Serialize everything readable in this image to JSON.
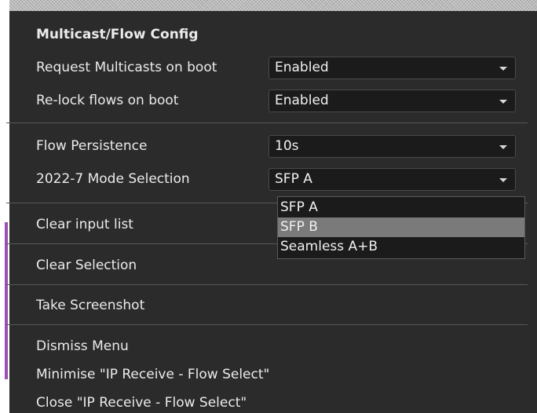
{
  "menu": {
    "section_title": "Multicast/Flow Config",
    "request_multicasts": {
      "label": "Request Multicasts on boot",
      "value": "Enabled"
    },
    "relock_flows": {
      "label": "Re-lock flows on boot",
      "value": "Enabled"
    },
    "flow_persistence": {
      "label": "Flow Persistence",
      "value": "10s"
    },
    "mode_selection": {
      "label": "2022-7 Mode Selection",
      "value": "SFP A",
      "options": [
        "SFP A",
        "SFP B",
        "Seamless A+B"
      ],
      "highlighted": "SFP B"
    },
    "clear_input_list": "Clear input list",
    "clear_selection": "Clear Selection",
    "take_screenshot": "Take Screenshot",
    "dismiss_menu": "Dismiss Menu",
    "minimise": "Minimise \"IP Receive - Flow Select\"",
    "close": "Close \"IP Receive - Flow Select\""
  },
  "colors": {
    "menu_background": "#2b2b2b",
    "field_background": "#1b1b1b",
    "highlight": "#7a7a7a",
    "accent_bar": "#9a4fb6"
  }
}
